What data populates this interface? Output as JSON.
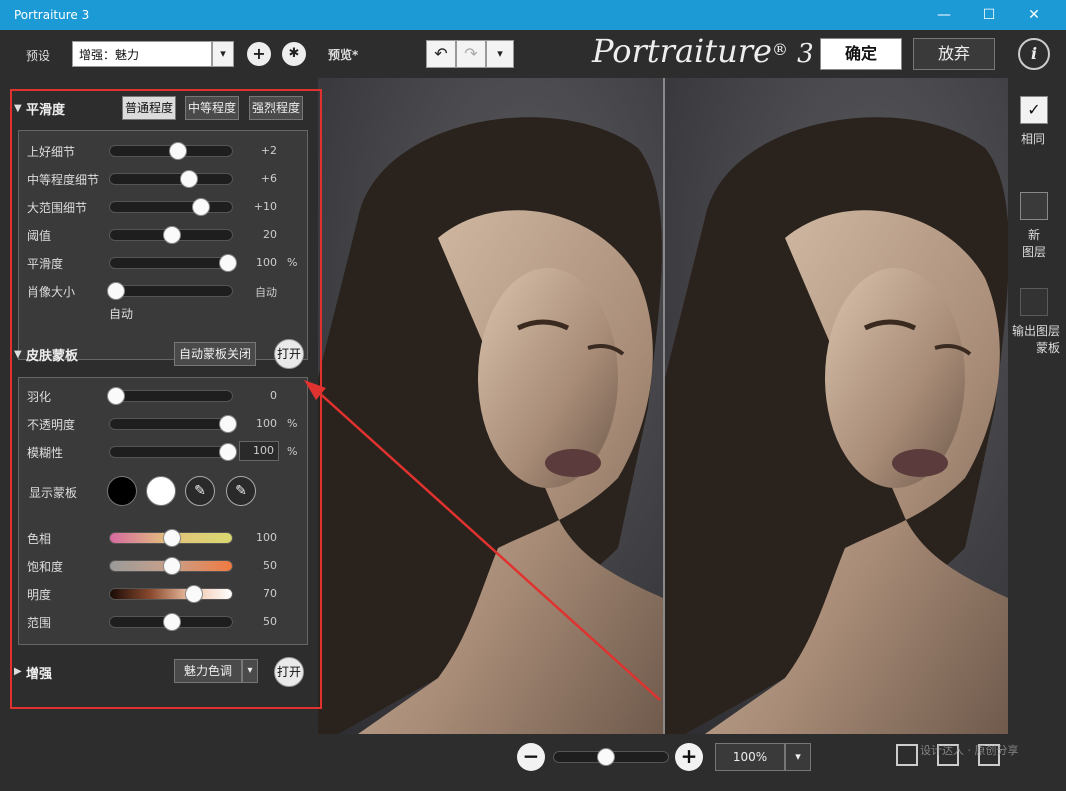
{
  "window": {
    "title": "Portraiture 3",
    "min_icon": "minimize-icon",
    "max_icon": "maximize-icon",
    "close_icon": "close-icon"
  },
  "toolbar": {
    "preset_label": "预设",
    "preset_value": "增强：魅力",
    "preview_label": "预览*",
    "logo_text": "Portraiture",
    "logo_reg": "®",
    "logo_num": "3",
    "ok_label": "确定",
    "cancel_label": "放弃",
    "info_glyph": "i",
    "add_glyph": "+",
    "gear_glyph": "✱",
    "dd_glyph": "▾",
    "undo_glyph": "↶",
    "redo_glyph": "↷"
  },
  "smooth": {
    "title": "平滑度",
    "buttons": [
      "普通程度",
      "中等程度",
      "强烈程度"
    ],
    "active": 0,
    "sliders": [
      {
        "label": "上好细节",
        "value": "+2",
        "pos": 0.55
      },
      {
        "label": "中等程度细节",
        "value": "+6",
        "pos": 0.64
      },
      {
        "label": "大范围细节",
        "value": "+10",
        "pos": 0.73
      },
      {
        "label": "阈值",
        "value": "20",
        "pos": 0.5
      },
      {
        "label": "平滑度",
        "value": "100",
        "unit": "%",
        "pos": 0.95
      },
      {
        "label": "肖像大小",
        "value": "自动",
        "pos": 0.05,
        "sub": "自动"
      }
    ]
  },
  "mask": {
    "title": "皮肤蒙板",
    "auto_label": "自动蒙板关闭",
    "open_label": "打开",
    "sliders": [
      {
        "label": "羽化",
        "value": "0",
        "pos": 0.05
      },
      {
        "label": "不透明度",
        "value": "100",
        "unit": "%",
        "pos": 0.95
      },
      {
        "label": "模糊性",
        "value": "100",
        "unit": "%",
        "pos": 0.95
      }
    ],
    "show_mask_label": "显示蒙板",
    "color_sliders": [
      {
        "label": "色相",
        "value": "100",
        "pos": 0.5
      },
      {
        "label": "饱和度",
        "value": "50",
        "pos": 0.5
      },
      {
        "label": "明度",
        "value": "70",
        "pos": 0.68
      },
      {
        "label": "范围",
        "value": "50",
        "pos": 0.5
      }
    ]
  },
  "enhance": {
    "title": "增强",
    "preset": "魅力色调",
    "open_label": "打开"
  },
  "right": {
    "same_label": "相同",
    "new_layer_label": "新\n图层",
    "output_label": "输出图层\n蒙板",
    "check_glyph": "✓"
  },
  "zoom": {
    "value": "100%",
    "minus": "−",
    "plus": "+",
    "level": 0.45
  },
  "watermark": "设计达人 · 原创分享"
}
